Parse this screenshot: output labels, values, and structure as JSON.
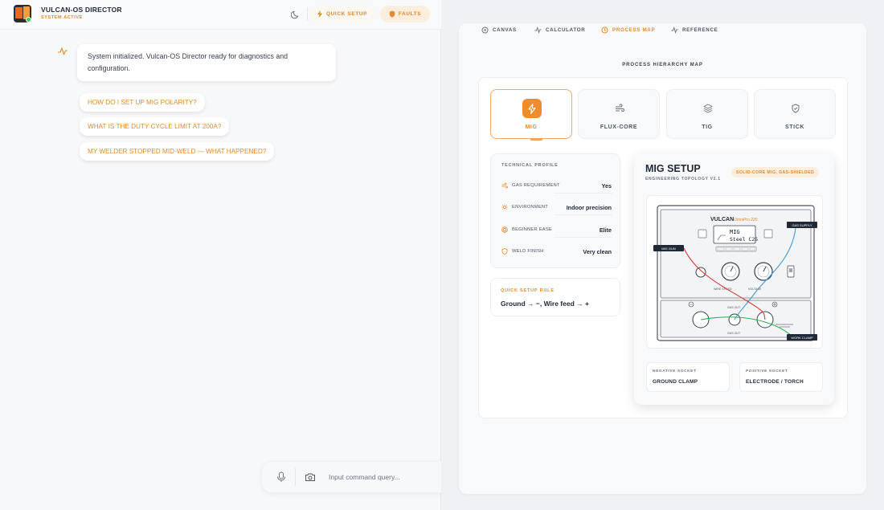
{
  "app": {
    "title": "VULCAN-OS DIRECTOR",
    "status": "SYSTEM ACTIVE",
    "quick_setup_label": "QUICK SETUP",
    "faults_label": "FAULTS"
  },
  "chat": {
    "message": "System initialized. Vulcan-OS Director ready for diagnostics and configuration.",
    "suggestions": [
      "HOW DO I SET UP MIG POLARITY?",
      "WHAT IS THE DUTY CYCLE LIMIT AT 200A?",
      "MY WELDER STOPPED MID-WELD — WHAT HAPPENED?"
    ]
  },
  "input": {
    "placeholder": "Input command query..."
  },
  "tabs": [
    {
      "label": "CANVAS",
      "icon": "canvas-icon"
    },
    {
      "label": "CALCULATOR",
      "icon": "pulse-icon"
    },
    {
      "label": "PROCESS MAP",
      "icon": "clock-icon",
      "active": true
    },
    {
      "label": "REFERENCE",
      "icon": "pulse-icon"
    }
  ],
  "process_map": {
    "title": "PROCESS HIERARCHY MAP",
    "processes": [
      {
        "label": "MIG",
        "icon": "bolt-icon",
        "active": true
      },
      {
        "label": "FLUX-CORE",
        "icon": "wind-icon"
      },
      {
        "label": "TIG",
        "icon": "layers-icon"
      },
      {
        "label": "STICK",
        "icon": "shield-icon"
      }
    ],
    "profile": {
      "title": "TECHNICAL PROFILE",
      "rows": [
        {
          "key": "GAS REQUIREMENT",
          "value": "Yes",
          "icon": "wind-icon"
        },
        {
          "key": "ENVIRONMENT",
          "value": "Indoor precision",
          "icon": "sun-icon"
        },
        {
          "key": "BEGINNER EASE",
          "value": "Elite",
          "icon": "target-icon"
        },
        {
          "key": "WELD FINISH",
          "value": "Very clean",
          "icon": "shield-icon"
        }
      ]
    },
    "rule": {
      "title": "QUICK SETUP RULE",
      "text": "Ground → −, Wire feed → +"
    },
    "setup": {
      "title": "MIG SETUP",
      "subtitle": "ENGINEERING TOPOLOGY V2.1",
      "badge": "SOLID-CORE MIG, GAS-SHIELDED",
      "negative_label": "NEGATIVE SOCKET",
      "negative_value": "GROUND CLAMP",
      "positive_label": "POSITIVE SOCKET",
      "positive_value": "ELECTRODE / TORCH"
    },
    "diagram": {
      "brand": "VULCAN",
      "model": "OmniPro 220",
      "screen_line1": "MIG",
      "screen_line2": "Steel C25",
      "gas_supply": "GAS SUPPLY",
      "mig_gun": "MIG GUN",
      "work_clamp": "WORK CLAMP",
      "wire_speed": "WIRE SPEED",
      "voltage": "VOLTAGE",
      "gas_out": "GAS OUT"
    }
  },
  "colors": {
    "accent": "#e38a2a",
    "positive_wire": "#d63a3a",
    "negative_wire": "#2fae4f",
    "gas_line": "#4a9ad8"
  }
}
